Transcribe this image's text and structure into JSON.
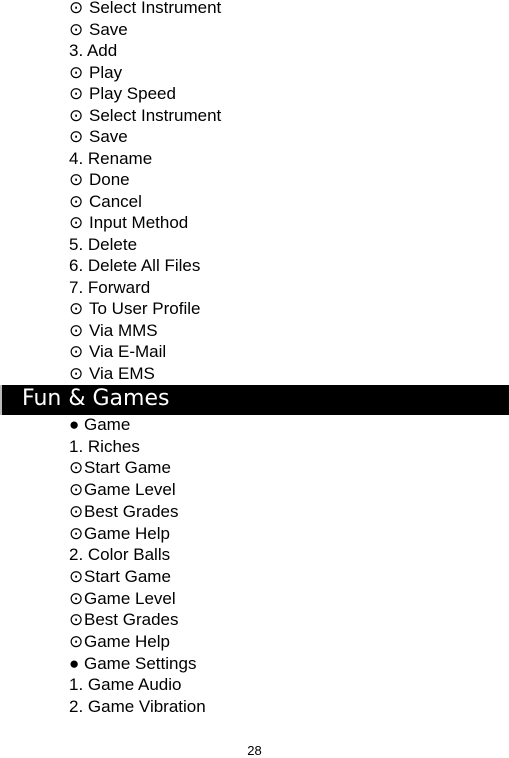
{
  "top_list": [
    {
      "marker": "⊙",
      "text": "Select Instrument"
    },
    {
      "marker": "⊙",
      "text": "Save"
    },
    {
      "marker": "",
      "text": "3. Add"
    },
    {
      "marker": "⊙",
      "text": "Play"
    },
    {
      "marker": "⊙",
      "text": "Play Speed"
    },
    {
      "marker": "⊙",
      "text": "Select Instrument"
    },
    {
      "marker": "⊙",
      "text": "Save"
    },
    {
      "marker": "",
      "text": "4. Rename"
    },
    {
      "marker": "⊙",
      "text": "Done"
    },
    {
      "marker": "⊙",
      "text": "Cancel"
    },
    {
      "marker": "⊙",
      "text": "Input Method"
    },
    {
      "marker": "",
      "text": "5. Delete"
    },
    {
      "marker": "",
      "text": "6. Delete All Files"
    },
    {
      "marker": "",
      "text": "7. Forward"
    },
    {
      "marker": "⊙",
      "text": "To User Profile"
    },
    {
      "marker": "⊙",
      "text": "Via MMS"
    },
    {
      "marker": "⊙",
      "text": "Via E-Mail"
    },
    {
      "marker": "⊙",
      "text": "Via EMS"
    }
  ],
  "section_header": "Fun & Games",
  "games_list": [
    {
      "marker": "●",
      "text": "Game"
    },
    {
      "marker": "",
      "text": "1. Riches"
    },
    {
      "marker": "⊙",
      "text": "Start Game"
    },
    {
      "marker": "⊙",
      "text": "Game Level"
    },
    {
      "marker": "⊙",
      "text": "Best Grades"
    },
    {
      "marker": "⊙",
      "text": "Game Help"
    },
    {
      "marker": "",
      "text": "2. Color Balls"
    },
    {
      "marker": "⊙",
      "text": "Start Game"
    },
    {
      "marker": "⊙",
      "text": "Game Level"
    },
    {
      "marker": "⊙",
      "text": "Best Grades"
    },
    {
      "marker": "⊙",
      "text": "Game Help"
    },
    {
      "marker": "●",
      "text": "Game Settings"
    },
    {
      "marker": "",
      "text": "1. Game Audio"
    },
    {
      "marker": "",
      "text": "2. Game Vibration"
    }
  ],
  "page_number": "28"
}
